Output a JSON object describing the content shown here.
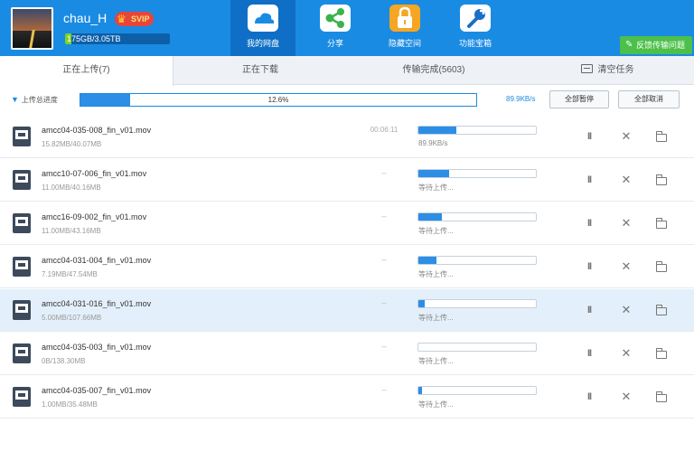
{
  "user": {
    "name": "chau_H",
    "badge": "SVIP",
    "quota": "175GB/3.05TB",
    "quota_fraction": 0.06
  },
  "nav": [
    {
      "label": "我的网盘",
      "icon": "cloud-icon",
      "active": true
    },
    {
      "label": "分享",
      "icon": "share-icon",
      "active": false
    },
    {
      "label": "隐藏空间",
      "icon": "lock-icon",
      "active": false
    },
    {
      "label": "功能宝箱",
      "icon": "wrench-icon",
      "active": false
    }
  ],
  "feedback": "反馈传输问题",
  "tabs": {
    "uploading": "正在上传(7)",
    "downloading": "正在下载",
    "completed": "传输完成(5603)",
    "clear": "清空任务"
  },
  "summary": {
    "label": "上传总进度",
    "percent": "12.6%",
    "fraction": 0.126,
    "speed": "89.9KB/s",
    "pause_all": "全部暂停",
    "cancel_all": "全部取消"
  },
  "files": [
    {
      "name": "amcc04-035-008_fin_v01.mov",
      "size": "15.82MB/40.07MB",
      "remaining": "00:06:11",
      "status": "89.9KB/s",
      "progress": 0.32
    },
    {
      "name": "amcc10-07-006_fin_v01.mov",
      "size": "11.00MB/40.16MB",
      "remaining": "--",
      "status": "等待上传...",
      "progress": 0.26
    },
    {
      "name": "amcc16-09-002_fin_v01.mov",
      "size": "11.00MB/43.16MB",
      "remaining": "--",
      "status": "等待上传...",
      "progress": 0.2
    },
    {
      "name": "amcc04-031-004_fin_v01.mov",
      "size": "7.19MB/47.54MB",
      "remaining": "--",
      "status": "等待上传...",
      "progress": 0.15
    },
    {
      "name": "amcc04-031-016_fin_v01.mov",
      "size": "5.00MB/107.66MB",
      "remaining": "--",
      "status": "等待上传...",
      "progress": 0.05,
      "selected": true
    },
    {
      "name": "amcc04-035-003_fin_v01.mov",
      "size": "0B/138.30MB",
      "remaining": "--",
      "status": "等待上传...",
      "progress": 0.0
    },
    {
      "name": "amcc04-035-007_fin_v01.mov",
      "size": "1.00MB/35.48MB",
      "remaining": "--",
      "status": "等待上传...",
      "progress": 0.03
    }
  ],
  "colors": {
    "header": "#1a8be3",
    "header_active": "#0f6fc6",
    "progress": "#2d8ee6",
    "selected_row": "#e3f0fb",
    "feedback": "#4cc04a"
  }
}
